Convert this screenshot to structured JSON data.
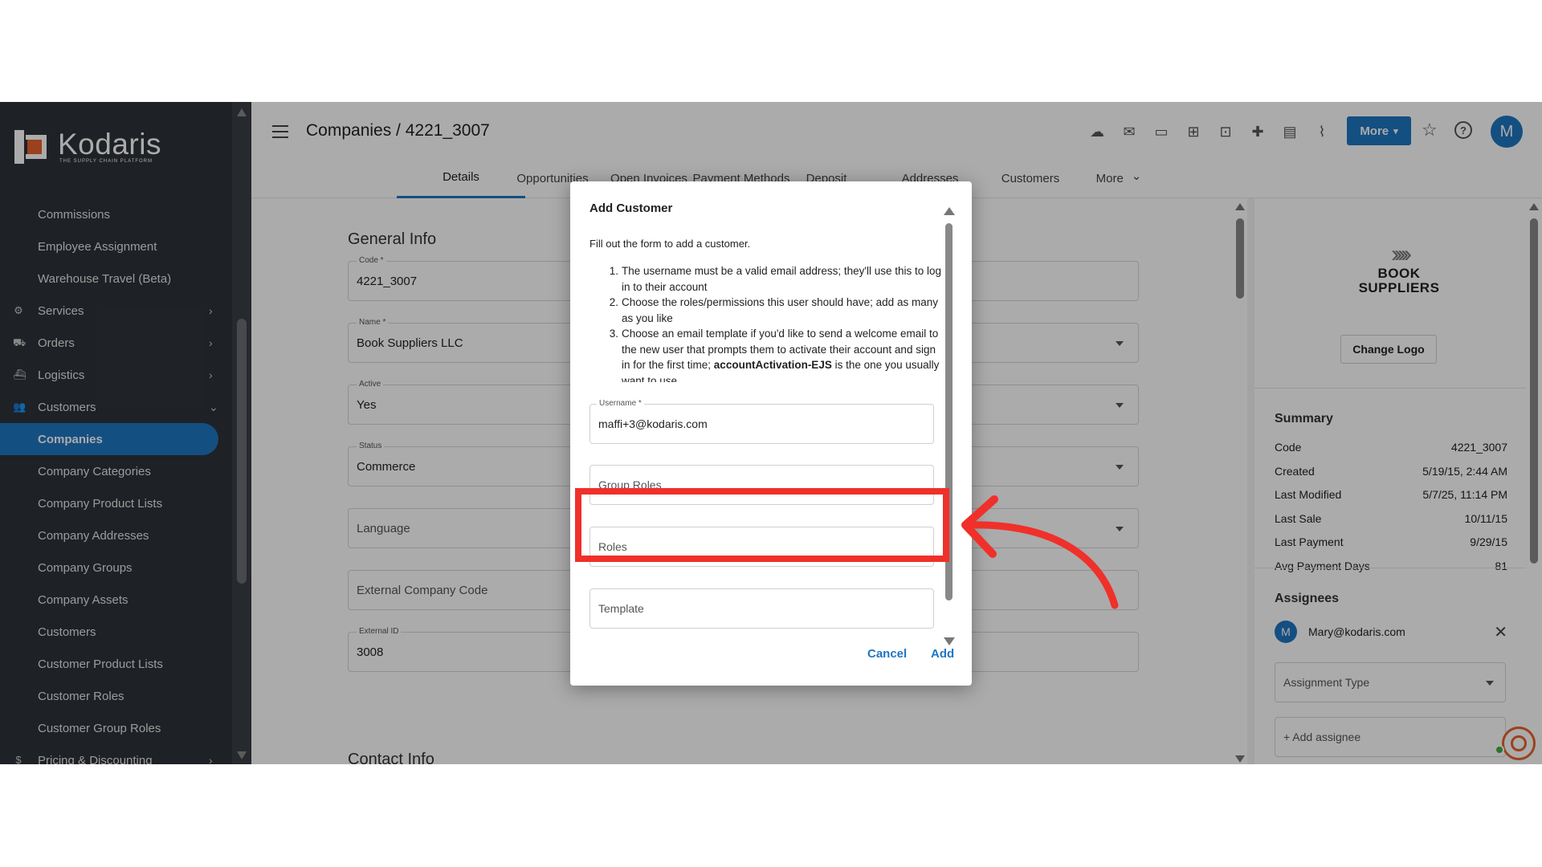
{
  "sidebar": {
    "brand": "Kodaris",
    "tagline": "THE SUPPLY CHAIN PLATFORM",
    "items": [
      {
        "label": "Commissions",
        "type": "sub"
      },
      {
        "label": "Employee Assignment",
        "type": "sub"
      },
      {
        "label": "Warehouse Travel (Beta)",
        "type": "sub"
      },
      {
        "label": "Services",
        "type": "group",
        "icon": "services-icon",
        "chevron": "›"
      },
      {
        "label": "Orders",
        "type": "group",
        "icon": "truck-icon",
        "chevron": "›"
      },
      {
        "label": "Logistics",
        "type": "group",
        "icon": "logistics-icon",
        "chevron": "›"
      },
      {
        "label": "Customers",
        "type": "group",
        "icon": "people-icon",
        "chevron": "⌄"
      },
      {
        "label": "Companies",
        "type": "sub",
        "active": true
      },
      {
        "label": "Company Categories",
        "type": "sub"
      },
      {
        "label": "Company Product Lists",
        "type": "sub"
      },
      {
        "label": "Company Addresses",
        "type": "sub"
      },
      {
        "label": "Company Groups",
        "type": "sub"
      },
      {
        "label": "Company Assets",
        "type": "sub"
      },
      {
        "label": "Customers",
        "type": "sub"
      },
      {
        "label": "Customer Product Lists",
        "type": "sub"
      },
      {
        "label": "Customer Roles",
        "type": "sub"
      },
      {
        "label": "Customer Group Roles",
        "type": "sub"
      },
      {
        "label": "Pricing & Discounting",
        "type": "group",
        "icon": "dollar-icon",
        "chevron": "›"
      }
    ]
  },
  "header": {
    "breadcrumb": "Companies / 4221_3007",
    "more_label": "More",
    "avatar_initial": "M",
    "icons": [
      "cloud-upload-icon",
      "mail-icon",
      "card-check-icon",
      "gift-icon",
      "monitor-add-icon",
      "person-add-icon",
      "file-add-icon",
      "paperclip-icon"
    ]
  },
  "tabs": [
    {
      "label": "Details",
      "active": true
    },
    {
      "label": "Opportunities"
    },
    {
      "label": "Open Invoices"
    },
    {
      "label": "Payment Methods"
    },
    {
      "label": "Deposit"
    },
    {
      "label": "Addresses"
    },
    {
      "label": "Customers"
    },
    {
      "label": "More"
    }
  ],
  "general": {
    "title": "General Info",
    "fields": [
      {
        "label": "Code *",
        "value": "4221_3007",
        "dropdown": false
      },
      {
        "label": "Name *",
        "value": "Book Suppliers LLC",
        "dropdown": true
      },
      {
        "label": "Active",
        "value": "Yes",
        "dropdown": true
      },
      {
        "label": "Status",
        "value": "Commerce",
        "dropdown": true
      },
      {
        "label": "",
        "placeholder": "Language",
        "dropdown": true
      },
      {
        "label": "",
        "placeholder": "External Company Code",
        "dropdown": false
      },
      {
        "label": "External ID",
        "value": "3008",
        "dropdown": false
      }
    ],
    "contact_title": "Contact Info"
  },
  "right_panel": {
    "logo_line1": "BOOK",
    "logo_line2": "SUPPLIERS",
    "change_logo": "Change Logo",
    "summary_title": "Summary",
    "summary": [
      {
        "k": "Code",
        "v": "4221_3007"
      },
      {
        "k": "Created",
        "v": "5/19/15, 2:44 AM"
      },
      {
        "k": "Last Modified",
        "v": "5/7/25, 11:14 PM"
      },
      {
        "k": "Last Sale",
        "v": "10/11/15"
      },
      {
        "k": "Last Payment",
        "v": "9/29/15"
      },
      {
        "k": "Avg Payment Days",
        "v": "81"
      }
    ],
    "assignees_title": "Assignees",
    "assignee_initial": "M",
    "assignee_email": "Mary@kodaris.com",
    "assignment_type_placeholder": "Assignment Type",
    "add_assignee": "+ Add assignee"
  },
  "dialog": {
    "title": "Add Customer",
    "intro": "Fill out the form to add a customer.",
    "steps": [
      {
        "n": "1.",
        "text": "The username must be a valid email address; they'll use this to log in to their account"
      },
      {
        "n": "2.",
        "text": "Choose the roles/permissions this user should have; add as many as you like"
      },
      {
        "n": "3.",
        "text": "Choose an email template if you'd like to send a welcome email to the new user that prompts them to activate their account and sign in for the first time; ",
        "bold": "accountActivation-EJS",
        "tail": " is the one you usually want to use."
      }
    ],
    "username_label": "Username *",
    "username_value": "maffi+3@kodaris.com",
    "group_roles_placeholder": "Group Roles",
    "roles_placeholder": "Roles",
    "template_placeholder": "Template",
    "cancel": "Cancel",
    "add": "Add"
  },
  "colors": {
    "accent": "#1f76c2",
    "sidebar_bg": "#2e3238",
    "annotation_red": "#f0302a",
    "brand_orange": "#e8622c"
  }
}
